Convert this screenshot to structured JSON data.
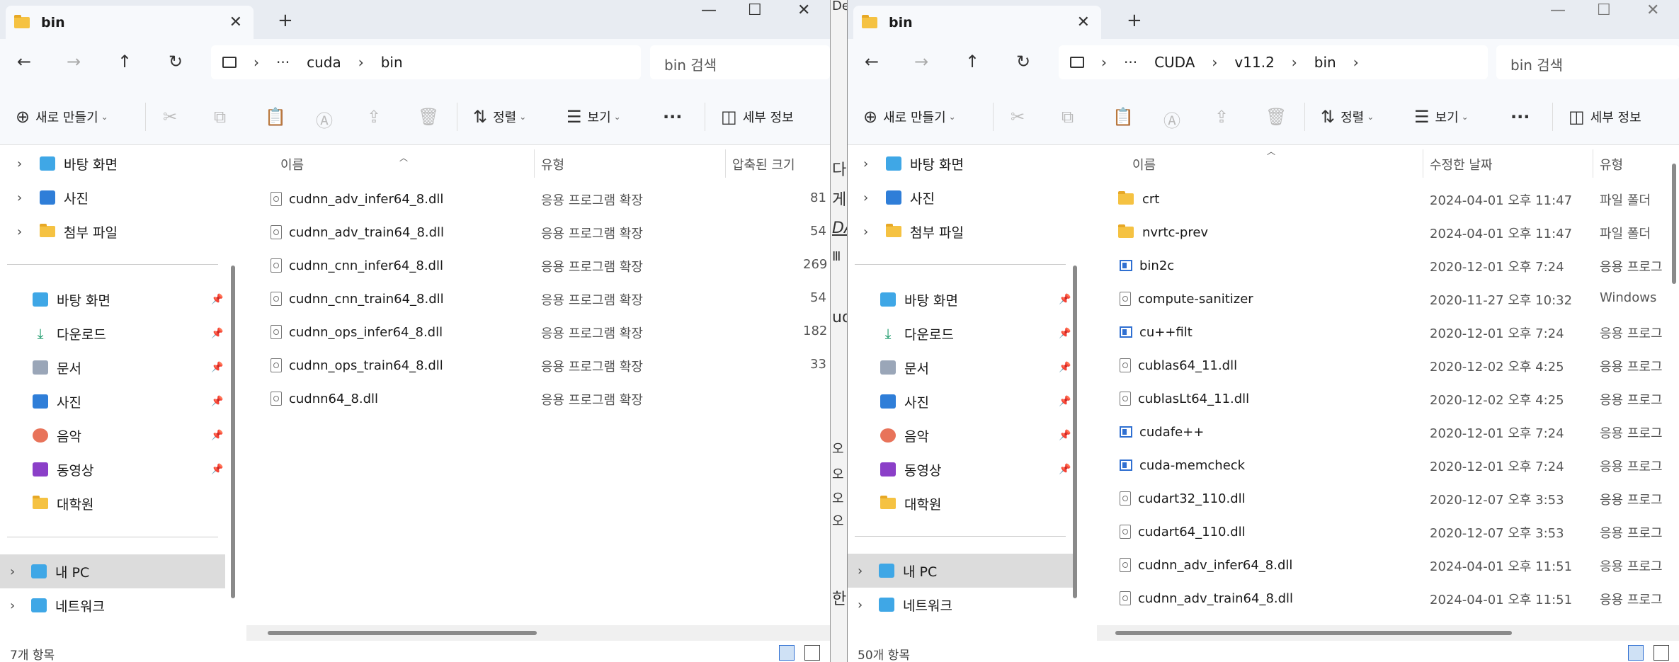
{
  "left": {
    "tab_title": "bin",
    "path": [
      "cuda",
      "bin"
    ],
    "search_placeholder": "bin 검색",
    "toolbar": {
      "new": "새로 만들기",
      "sort": "정렬",
      "view": "보기",
      "details": "세부 정보"
    },
    "columns": {
      "name": "이름",
      "type": "유형",
      "compressed": "압축된 크기"
    },
    "files": [
      {
        "name": "cudnn_adv_infer64_8.dll",
        "type": "응용 프로그램 확장",
        "size": "81"
      },
      {
        "name": "cudnn_adv_train64_8.dll",
        "type": "응용 프로그램 확장",
        "size": "54"
      },
      {
        "name": "cudnn_cnn_infer64_8.dll",
        "type": "응용 프로그램 확장",
        "size": "269"
      },
      {
        "name": "cudnn_cnn_train64_8.dll",
        "type": "응용 프로그램 확장",
        "size": "54"
      },
      {
        "name": "cudnn_ops_infer64_8.dll",
        "type": "응용 프로그램 확장",
        "size": "182"
      },
      {
        "name": "cudnn_ops_train64_8.dll",
        "type": "응용 프로그램 확장",
        "size": "33"
      },
      {
        "name": "cudnn64_8.dll",
        "type": "응용 프로그램 확장",
        "size": ""
      }
    ],
    "status": "7개 항목"
  },
  "right": {
    "tab_title": "bin",
    "path": [
      "CUDA",
      "v11.2",
      "bin"
    ],
    "search_placeholder": "bin 검색",
    "toolbar": {
      "new": "새로 만들기",
      "sort": "정렬",
      "view": "보기",
      "details": "세부 정보"
    },
    "columns": {
      "name": "이름",
      "modified": "수정한 날짜",
      "type": "유형"
    },
    "files": [
      {
        "name": "crt",
        "kind": "folder",
        "date": "2024-04-01 오후 11:47",
        "type": "파일 폴더"
      },
      {
        "name": "nvrtc-prev",
        "kind": "folder",
        "date": "2024-04-01 오후 11:47",
        "type": "파일 폴더"
      },
      {
        "name": "bin2c",
        "kind": "exe",
        "date": "2020-12-01 오후 7:24",
        "type": "응용 프로그"
      },
      {
        "name": "compute-sanitizer",
        "kind": "file",
        "date": "2020-11-27 오후 10:32",
        "type": "Windows"
      },
      {
        "name": "cu++filt",
        "kind": "exe",
        "date": "2020-12-01 오후 7:24",
        "type": "응용 프로그"
      },
      {
        "name": "cublas64_11.dll",
        "kind": "file",
        "date": "2020-12-02 오후 4:25",
        "type": "응용 프로그"
      },
      {
        "name": "cublasLt64_11.dll",
        "kind": "file",
        "date": "2020-12-02 오후 4:25",
        "type": "응용 프로그"
      },
      {
        "name": "cudafe++",
        "kind": "exe",
        "date": "2020-12-01 오후 7:24",
        "type": "응용 프로그"
      },
      {
        "name": "cuda-memcheck",
        "kind": "exe",
        "date": "2020-12-01 오후 7:24",
        "type": "응용 프로그"
      },
      {
        "name": "cudart32_110.dll",
        "kind": "file",
        "date": "2020-12-07 오후 3:53",
        "type": "응용 프로그"
      },
      {
        "name": "cudart64_110.dll",
        "kind": "file",
        "date": "2020-12-07 오후 3:53",
        "type": "응용 프로그"
      },
      {
        "name": "cudnn_adv_infer64_8.dll",
        "kind": "file",
        "date": "2024-04-01 오후 11:51",
        "type": "응용 프로그"
      },
      {
        "name": "cudnn_adv_train64_8.dll",
        "kind": "file",
        "date": "2024-04-01 오후 11:51",
        "type": "응용 프로그"
      }
    ],
    "status": "50개 항목"
  },
  "sidebar": {
    "top": [
      "바탕 화면",
      "사진",
      "첨부 파일"
    ],
    "quick": [
      "바탕 화면",
      "다운로드",
      "문서",
      "사진",
      "음악",
      "동영상",
      "대학원"
    ],
    "bottom": [
      "내 PC",
      "네트워크"
    ]
  },
  "behind_text": [
    "De",
    "다",
    "게",
    "DA",
    "Ⅲ",
    "ud",
    "오",
    "오",
    "오",
    "오",
    "한"
  ]
}
